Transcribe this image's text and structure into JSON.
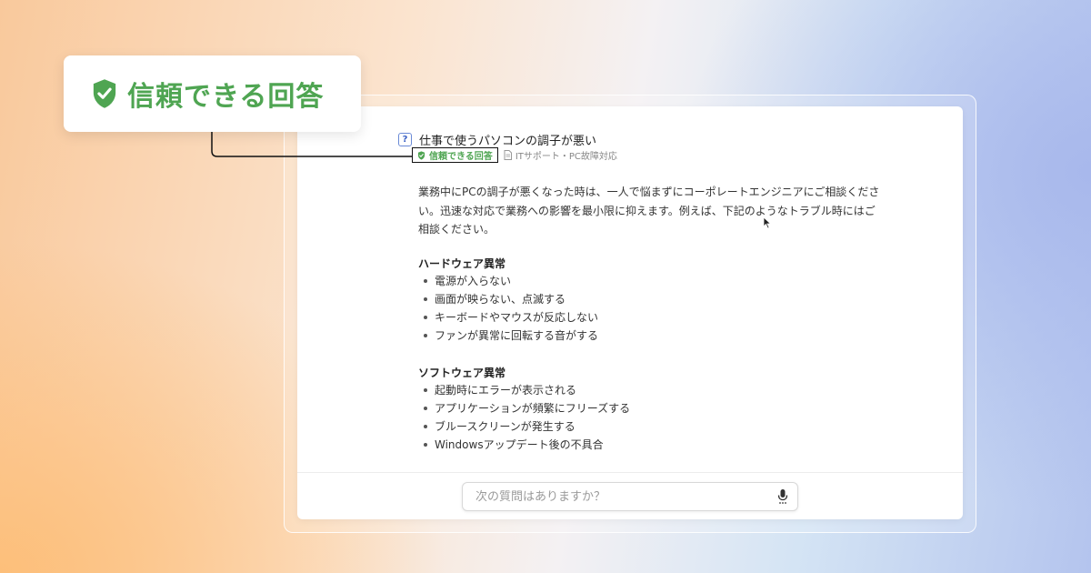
{
  "callout": {
    "label": "信頼できる回答"
  },
  "question": {
    "icon": "question-square-icon",
    "text": "仕事で使うパソコンの調子が悪い"
  },
  "meta": {
    "badge_label": "信頼できる回答",
    "category": "ITサポート・PC故障対応"
  },
  "answer": {
    "intro_lines": [
      "業務中にPCの調子が悪くなった時は、一人で悩まずにコーポレートエンジニアにご相談くださ",
      "い。迅速な対応で業務への影響を最小限に抑えます。例えば、下記のようなトラブル時にはご",
      "相談ください。"
    ],
    "sections": [
      {
        "title": "ハードウェア異常",
        "items": [
          "電源が入らない",
          "画面が映らない、点滅する",
          "キーボードやマウスが反応しない",
          "ファンが異常に回転する音がする"
        ]
      },
      {
        "title": "ソフトウェア異常",
        "items": [
          "起動時にエラーが表示される",
          "アプリケーションが頻繁にフリーズする",
          "ブルースクリーンが発生する",
          "Windowsアップデート後の不具合"
        ]
      }
    ]
  },
  "input": {
    "placeholder": "次の質問はありますか？",
    "value": ""
  },
  "colors": {
    "trusted_green": "#4fa552",
    "question_blue": "#3a5fc4"
  }
}
